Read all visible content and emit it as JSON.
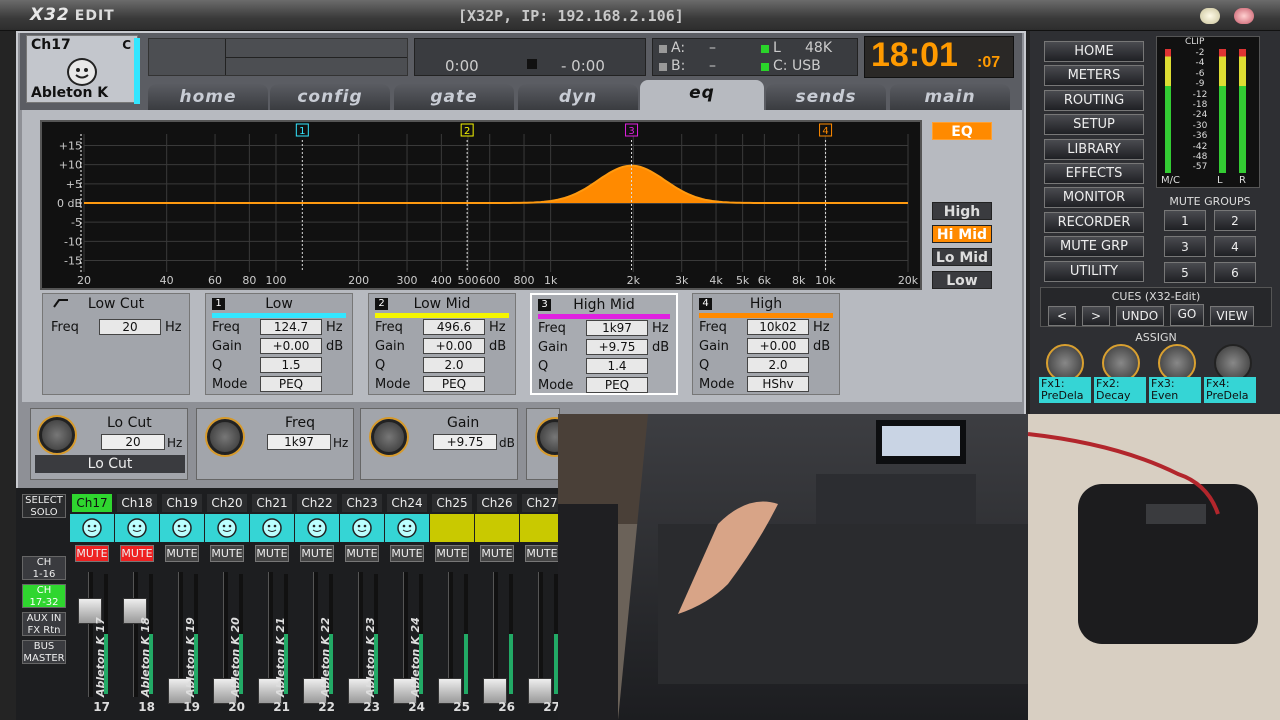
{
  "title": {
    "logo": "X32",
    "logo_suffix": "EDIT",
    "device": "[X32P, IP: 192.168.2.106]"
  },
  "channel": {
    "id": "Ch17",
    "c": "C",
    "name": "Ableton K"
  },
  "transport": {
    "time_a": "0:00",
    "time_b": "- 0:00"
  },
  "media": {
    "a_label": "A:",
    "a_val": "–",
    "b_label": "B:",
    "b_val": "–",
    "l_label": "L",
    "rate": "48K",
    "c_label": "C: USB"
  },
  "clock": {
    "time": "18:01",
    "sec": ":07"
  },
  "tabs": [
    "home",
    "config",
    "gate",
    "dyn",
    "eq",
    "sends",
    "main"
  ],
  "eq": {
    "db_labels": [
      "+15",
      "+10",
      "+5",
      "0 dB",
      "-5",
      "-10",
      "-15"
    ],
    "freq_labels": [
      "20",
      "40",
      "60",
      "80",
      "100",
      "200",
      "300",
      "400",
      "500",
      "600",
      "800",
      "1k",
      "2k",
      "3k",
      "4k",
      "5k",
      "6k",
      "8k",
      "10k",
      "20k"
    ],
    "markers": [
      "1",
      "2",
      "3",
      "4"
    ],
    "eq_button": "EQ",
    "band_buttons": [
      "High",
      "Hi Mid",
      "Lo Mid",
      "Low"
    ],
    "lowcut": {
      "title": "Low Cut",
      "freq_label": "Freq",
      "freq": "20",
      "unit": "Hz"
    },
    "bands": [
      {
        "num": "1",
        "name": "Low",
        "freq": "124.7",
        "gain": "+0.00",
        "q": "1.5",
        "mode": "PEQ",
        "color": "#33e6ff"
      },
      {
        "num": "2",
        "name": "Low Mid",
        "freq": "496.6",
        "gain": "+0.00",
        "q": "2.0",
        "mode": "PEQ",
        "color": "#f5f500"
      },
      {
        "num": "3",
        "name": "High Mid",
        "freq": "1k97",
        "gain": "+9.75",
        "q": "1.4",
        "mode": "PEQ",
        "color": "#e020e0"
      },
      {
        "num": "4",
        "name": "High",
        "freq": "10k02",
        "gain": "+0.00",
        "q": "2.0",
        "mode": "HShv",
        "color": "#ff8a00"
      }
    ],
    "field_labels": {
      "freq": "Freq",
      "gain": "Gain",
      "q": "Q",
      "mode": "Mode",
      "hz": "Hz",
      "db": "dB"
    }
  },
  "knobs": {
    "locut": {
      "title": "Lo Cut",
      "val": "20",
      "unit": "Hz",
      "footer": "Lo Cut"
    },
    "freq": {
      "title": "Freq",
      "val": "1k97",
      "unit": "Hz"
    },
    "gain": {
      "title": "Gain",
      "val": "+9.75",
      "unit": "dB"
    }
  },
  "nav": [
    "HOME",
    "METERS",
    "ROUTING",
    "SETUP",
    "LIBRARY",
    "EFFECTS",
    "MONITOR",
    "RECORDER",
    "MUTE GRP",
    "UTILITY"
  ],
  "meter": {
    "clip": "CLIP",
    "scale": [
      "-2",
      "-4",
      "-6",
      "-9",
      "-12",
      "-18",
      "-24",
      "-30",
      "-36",
      "-42",
      "-48",
      "-57"
    ],
    "mc": "M/C",
    "l": "L",
    "r": "R"
  },
  "mute_groups": {
    "title": "MUTE GROUPS",
    "buttons": [
      "1",
      "2",
      "3",
      "4",
      "5",
      "6"
    ]
  },
  "cues": {
    "title": "CUES (X32-Edit)",
    "prev": "<",
    "next": ">",
    "undo": "UNDO",
    "go": "GO",
    "view": "VIEW"
  },
  "assign": {
    "title": "ASSIGN",
    "fx": [
      [
        "Fx1:",
        "PreDela"
      ],
      [
        "Fx2:",
        "Decay"
      ],
      [
        "Fx3:",
        "Even"
      ],
      [
        "Fx4:",
        "PreDela"
      ]
    ]
  },
  "side": {
    "select": "SELECT",
    "solo": "SOLO",
    "ch116": [
      "CH",
      "1-16"
    ],
    "ch1732": [
      "CH",
      "17-32"
    ],
    "aux": [
      "AUX IN",
      "FX Rtn"
    ],
    "bus": [
      "BUS",
      "MASTER"
    ]
  },
  "strips": [
    {
      "label": "Ch17",
      "name": "Ableton K 17",
      "num": "17",
      "mute": "MUTE",
      "muted": true,
      "selected": true
    },
    {
      "label": "Ch18",
      "name": "Ableton K 18",
      "num": "18",
      "mute": "MUTE",
      "muted": true
    },
    {
      "label": "Ch19",
      "name": "Ableton K 19",
      "num": "19",
      "mute": "MUTE"
    },
    {
      "label": "Ch20",
      "name": "Ableton K 20",
      "num": "20",
      "mute": "MUTE"
    },
    {
      "label": "Ch21",
      "name": "Ableton K 21",
      "num": "21",
      "mute": "MUTE"
    },
    {
      "label": "Ch22",
      "name": "Ableton K 22",
      "num": "22",
      "mute": "MUTE"
    },
    {
      "label": "Ch23",
      "name": "Ableton K 23",
      "num": "23",
      "mute": "MUTE"
    },
    {
      "label": "Ch24",
      "name": "Ableton K 24",
      "num": "24",
      "mute": "MUTE"
    },
    {
      "label": "Ch25",
      "name": "",
      "num": "25",
      "mute": "MUTE"
    },
    {
      "label": "Ch26",
      "name": "",
      "num": "26",
      "mute": "MUTE"
    },
    {
      "label": "Ch27",
      "name": "",
      "num": "27",
      "mute": "MUTE"
    }
  ]
}
